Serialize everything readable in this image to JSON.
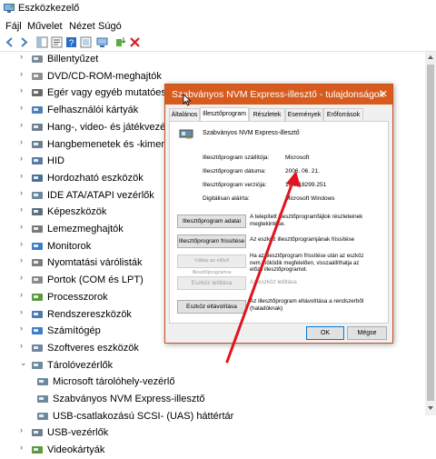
{
  "window": {
    "title": "Eszközkezelő"
  },
  "menu": [
    "Fájl",
    "Művelet",
    "Nézet",
    "Súgó"
  ],
  "tree": {
    "nodes": [
      {
        "label": "Billentyűzet",
        "icon": "keyboard-icon",
        "expanded": false
      },
      {
        "label": "DVD/CD-ROM-meghajtók",
        "icon": "disc-drive-icon",
        "expanded": false
      },
      {
        "label": "Egér vagy egyéb mutatóeszköz",
        "icon": "mouse-icon",
        "expanded": false
      },
      {
        "label": "Felhasználói kártyák",
        "icon": "card-icon",
        "expanded": false
      },
      {
        "label": "Hang-, video- és játékvezérlők",
        "icon": "speaker-icon",
        "expanded": false
      },
      {
        "label": "Hangbemenetek és -kimenetek",
        "icon": "speaker-icon",
        "expanded": false
      },
      {
        "label": "HID",
        "icon": "hid-icon",
        "expanded": false
      },
      {
        "label": "Hordozható eszközök",
        "icon": "portable-device-icon",
        "expanded": false
      },
      {
        "label": "IDE ATA/ATAPI vezérlők",
        "icon": "ide-controller-icon",
        "expanded": false
      },
      {
        "label": "Képeszközök",
        "icon": "camera-icon",
        "expanded": false
      },
      {
        "label": "Lemezmeghajtók",
        "icon": "disk-drive-icon",
        "expanded": false
      },
      {
        "label": "Monitorok",
        "icon": "monitor-icon",
        "expanded": false
      },
      {
        "label": "Nyomtatási várólisták",
        "icon": "printer-icon",
        "expanded": false
      },
      {
        "label": "Portok (COM és LPT)",
        "icon": "port-icon",
        "expanded": false
      },
      {
        "label": "Processzorok",
        "icon": "processor-icon",
        "expanded": false
      },
      {
        "label": "Rendszereszközök",
        "icon": "system-device-icon",
        "expanded": false
      },
      {
        "label": "Számítógép",
        "icon": "computer-icon",
        "expanded": false
      },
      {
        "label": "Szoftveres eszközök",
        "icon": "software-device-icon",
        "expanded": false
      },
      {
        "label": "Tárolóvezérlők",
        "icon": "storage-controller-icon",
        "expanded": true,
        "children": [
          "Microsoft tárolóhely-vezérlő",
          "Szabványos NVM Express-illesztő",
          "USB-csatlakozású SCSI- (UAS) háttértár"
        ]
      },
      {
        "label": "USB-vezérlők",
        "icon": "usb-icon",
        "expanded": false
      },
      {
        "label": "Videokártyák",
        "icon": "display-adapter-icon",
        "expanded": false
      }
    ]
  },
  "dialog": {
    "title": "Szabványos NVM Express-illesztő - tulajdonságok",
    "tabs": [
      "Általános",
      "Illesztőprogram",
      "Részletek",
      "Események",
      "Erőforrások"
    ],
    "device_name": "Szabványos NVM Express-illesztő",
    "props": [
      {
        "label": "Illesztőprogram szállítója:",
        "value": "Microsoft"
      },
      {
        "label": "Illesztőprogram dátuma:",
        "value": "2006. 06. 21."
      },
      {
        "label": "Illesztőprogram verziója:",
        "value": "10.0.18299.251"
      },
      {
        "label": "Digitálisan aláírta:",
        "value": "Microsoft Windows"
      }
    ],
    "actions": [
      {
        "button": "Illesztőprogram adatai",
        "desc": "A telepített illesztőprogramfájlok részleteinek megtekintése.",
        "disabled": false
      },
      {
        "button": "Illesztőprogram frissítése",
        "desc": "Az eszköz illesztőprogramjának frissítése",
        "disabled": false
      },
      {
        "button": "Váltás az előző illesztőprogramra",
        "desc": "Ha az illesztőprogram frissítése után az eszköz nem működik megfelelően, visszaállíthatja az előző illesztőprogramot.",
        "disabled": true
      },
      {
        "button": "Eszköz letiltása",
        "desc": "Az eszköz letiltása",
        "disabled": true
      },
      {
        "button": "Eszköz eltávolítása",
        "desc": "Az illesztőprogram eltávolítása a rendszerből (haladóknak)",
        "disabled": false
      }
    ],
    "ok": "OK",
    "cancel": "Mégse"
  },
  "colors": {
    "dialog_accent": "#d75b1e",
    "annotation_arrow": "#e0141e"
  }
}
